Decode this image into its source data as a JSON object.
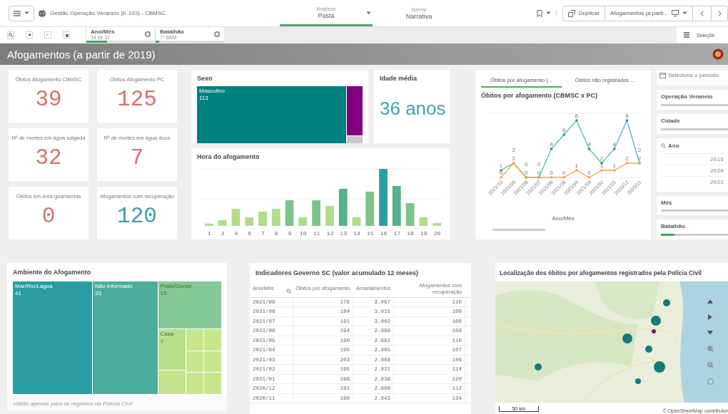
{
  "app_bar": {
    "app_title": "Gestão Operação Veraneio (E-193) - CBMSC",
    "modes": [
      {
        "caption": "Analisar",
        "label": "Pasta",
        "selected": true
      },
      {
        "caption": "Narrar",
        "label": "Narrativa",
        "selected": false
      }
    ],
    "duplicate_button": "Duplicar",
    "sheet_selector": "Afogamentos (a parti..."
  },
  "selection_bar": {
    "filters": [
      {
        "field": "Ano/Mês",
        "value": "34 de 52",
        "level": 0.3
      },
      {
        "field": "Batalhão",
        "value": "7º BBM",
        "level": 0.05
      }
    ],
    "selections_button": "Seleçõe"
  },
  "sheet_title": "Afogamentos (a partir de 2019)",
  "kpis": [
    {
      "label": "Óbitos Afogamento CBMSC",
      "value": "39",
      "color": "#d9706f"
    },
    {
      "label": "Óbitos Afogamento PC",
      "value": "125",
      "color": "#d9706f"
    },
    {
      "label": "Nº de mortes em água salgada",
      "value": "32",
      "color": "#d9706f"
    },
    {
      "label": "Nº de mortes em água doce",
      "value": "7",
      "color": "#d9706f"
    },
    {
      "label": "Óbitos em área guarnecida",
      "value": "0",
      "color": "#d9706f"
    },
    {
      "label": "Afogamentos com recuperação",
      "value": "120",
      "color": "#3a9fa8"
    }
  ],
  "sex_chart": {
    "title": "Sexo",
    "segments": [
      {
        "label": "Masculino",
        "value": "113",
        "color": "#00807f"
      },
      {
        "color": "#800080"
      },
      {
        "color": "#c8c8c8"
      }
    ]
  },
  "average_age": {
    "title": "Idade média",
    "value": "36 anos"
  },
  "hour_chart": {
    "title": "Hora do afogamento",
    "hours": [
      "1",
      "2",
      "4",
      "6",
      "7",
      "8",
      "9",
      "10",
      "11",
      "12",
      "13",
      "14",
      "15",
      "16",
      "17",
      "18",
      "19",
      "20"
    ]
  },
  "deaths_panel": {
    "tabs": [
      {
        "label": "Óbitos por afogamento (...",
        "selected": true
      },
      {
        "label": "Óbitos não registrados ...",
        "selected": false
      }
    ],
    "title": "Óbitos por afogamento (CBMSC x PC)",
    "chart_data": {
      "type": "line",
      "xlabel": "Ano/Mês",
      "categories": [
        "2021/10",
        "2021/09",
        "2021/08",
        "2021/07",
        "2021/06",
        "2021/05",
        "2021/04",
        "2021/03",
        "2021/02",
        "2021/01",
        "2020/12",
        "2020/11"
      ],
      "data_labels": true,
      "series": [
        {
          "color": "#4fb8bf",
          "values": [
            1,
            2,
            0,
            0,
            4,
            6,
            8,
            4,
            2,
            4,
            8,
            2
          ]
        },
        {
          "color": "#f5a445",
          "values": [
            0,
            2,
            0,
            0,
            0,
            0,
            1,
            0,
            1,
            1,
            2,
            2
          ]
        }
      ]
    }
  },
  "filter_panel": {
    "period_button": "Selecione o período",
    "fields": [
      {
        "kind": "field",
        "label": "Operação Veraneio"
      },
      {
        "kind": "field",
        "label": "Cidade"
      },
      {
        "kind": "list",
        "label": "Ano",
        "values": [
          "2019",
          "2020",
          "2021"
        ]
      },
      {
        "kind": "field",
        "label": "Mês"
      },
      {
        "kind": "field",
        "label": "Batalhão",
        "level": 0.2
      }
    ]
  },
  "environment_chart": {
    "title": "Ambiente do Afogamento",
    "tiles": [
      {
        "label": "Mar/Rio/Lagoa",
        "value": "41",
        "color": "#2a9da3"
      },
      {
        "label": "Não informado",
        "value": "33",
        "color": "#4cad9e"
      },
      {
        "label": "Praia/Dunas",
        "value": "15",
        "color": "#84c995"
      },
      {
        "label": "Casa",
        "value": "7",
        "color": "#b6df8c"
      }
    ],
    "footnote": "Válido apenas para os registros da Polícia Civil"
  },
  "indicators_table": {
    "title": "Indicadores Governo SC (valor acumulado 12 meses)",
    "columns": [
      "Ano/Mês",
      "Óbitos por afogamento",
      "Arrastamentos",
      "Afogamentos com recuperação"
    ],
    "rows": [
      [
        "2021/09",
        "179",
        "3.067",
        "110"
      ],
      [
        "2021/08",
        "184",
        "3.015",
        "109"
      ],
      [
        "2021/07",
        "191",
        "3.002",
        "109"
      ],
      [
        "2021/06",
        "194",
        "2.999",
        "109"
      ],
      [
        "2021/05",
        "190",
        "2.982",
        "110"
      ],
      [
        "2021/04",
        "195",
        "2.965",
        "107"
      ],
      [
        "2021/03",
        "203",
        "2.888",
        "106"
      ],
      [
        "2021/02",
        "195",
        "2.831",
        "114"
      ],
      [
        "2021/01",
        "199",
        "2.838",
        "120"
      ],
      [
        "2020/12",
        "191",
        "2.900",
        "112"
      ],
      [
        "2020/11",
        "190",
        "2.943",
        "134"
      ]
    ]
  },
  "map": {
    "title": "Localização dos óbitos por afogamentos registrados pela Polícia Civil",
    "scale": "50 km",
    "attribution": "© OpenStreetMap contributor"
  }
}
